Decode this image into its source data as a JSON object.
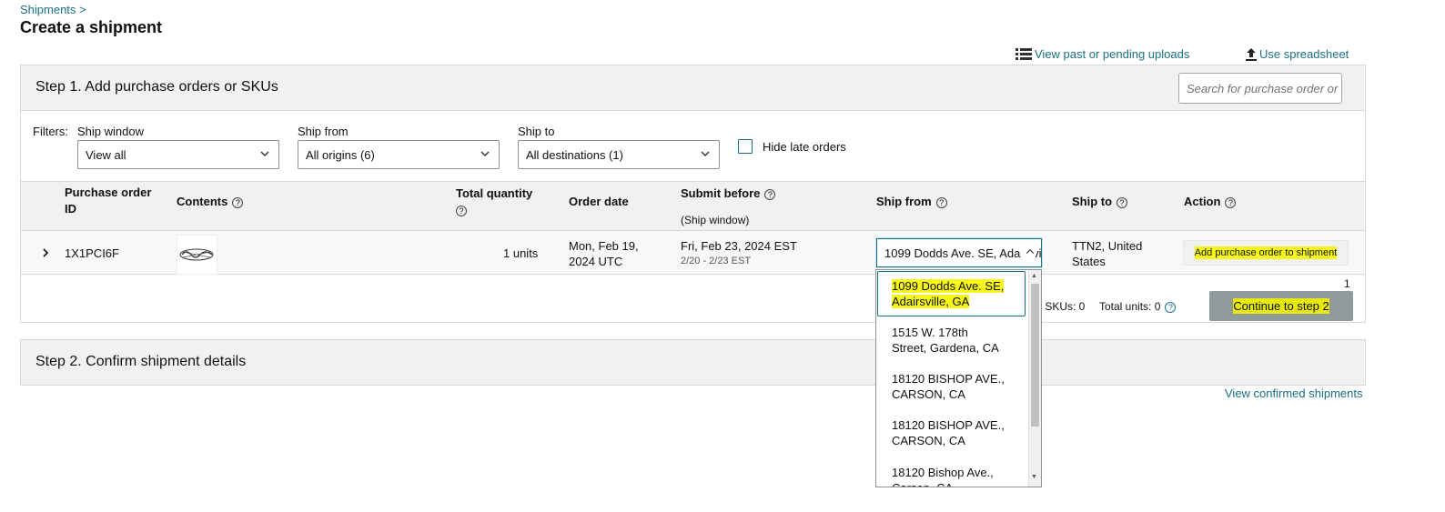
{
  "header": {
    "breadcrumb": "Shipments >",
    "title": "Create a shipment",
    "view_uploads": "View past or pending uploads",
    "use_spreadsheet": "Use spreadsheet"
  },
  "step1": {
    "title": "Step 1. Add purchase orders or SKUs",
    "search_placeholder": "Search for purchase order or"
  },
  "filters": {
    "label": "Filters:",
    "ship_window_label": "Ship window",
    "ship_window_value": "View all",
    "ship_from_label": "Ship from",
    "ship_from_value": "All origins (6)",
    "ship_to_label": "Ship to",
    "ship_to_value": "All destinations (1)",
    "hide_late_label": "Hide late orders"
  },
  "table": {
    "headers": {
      "po_line1": "Purchase order",
      "po_line2": "ID",
      "contents": "Contents",
      "total_quantity": "Total quantity",
      "order_date": "Order date",
      "submit_before": "Submit before",
      "ship_window_note": "(Ship window)",
      "ship_from": "Ship from",
      "ship_to": "Ship to",
      "action": "Action"
    },
    "row": {
      "po_id": "1X1PCI6F",
      "quantity": "1 units",
      "order_date_line1": "Mon, Feb 19,",
      "order_date_line2": "2024 UTC",
      "submit_before": "Fri, Feb 23, 2024 EST",
      "submit_window": "2/20 - 2/23 EST",
      "ship_from_value": "1099 Dodds Ave. SE, Adairsville, GA",
      "ship_to_line1": "TTN2, United",
      "ship_to_line2": "States",
      "action_label": "Add purchase order to shipment"
    }
  },
  "summary": {
    "page_count": "1",
    "skus_text": "r SKUs: 0",
    "units_text": "Total units: 0",
    "continue_label": "Continue to step 2"
  },
  "step2": {
    "title": "Step 2. Confirm shipment details",
    "view_confirmed": "View confirmed shipments"
  },
  "dropdown": {
    "options": [
      {
        "line1": "1099 Dodds Ave. SE,",
        "line2": "Adairsville, GA"
      },
      {
        "line1": "1515 W. 178th",
        "line2": "Street, Gardena, CA"
      },
      {
        "line1": "18120 BISHOP AVE.,",
        "line2": "CARSON, CA"
      },
      {
        "line1": "18120 BISHOP AVE.,",
        "line2": "CARSON, CA"
      },
      {
        "line1": "18120 Bishop Ave.,",
        "line2": "Carson, CA"
      }
    ]
  },
  "colors": {
    "link": "#1a6e83",
    "highlight": "#f6f61a",
    "panel_bg": "#f0f2f2"
  }
}
